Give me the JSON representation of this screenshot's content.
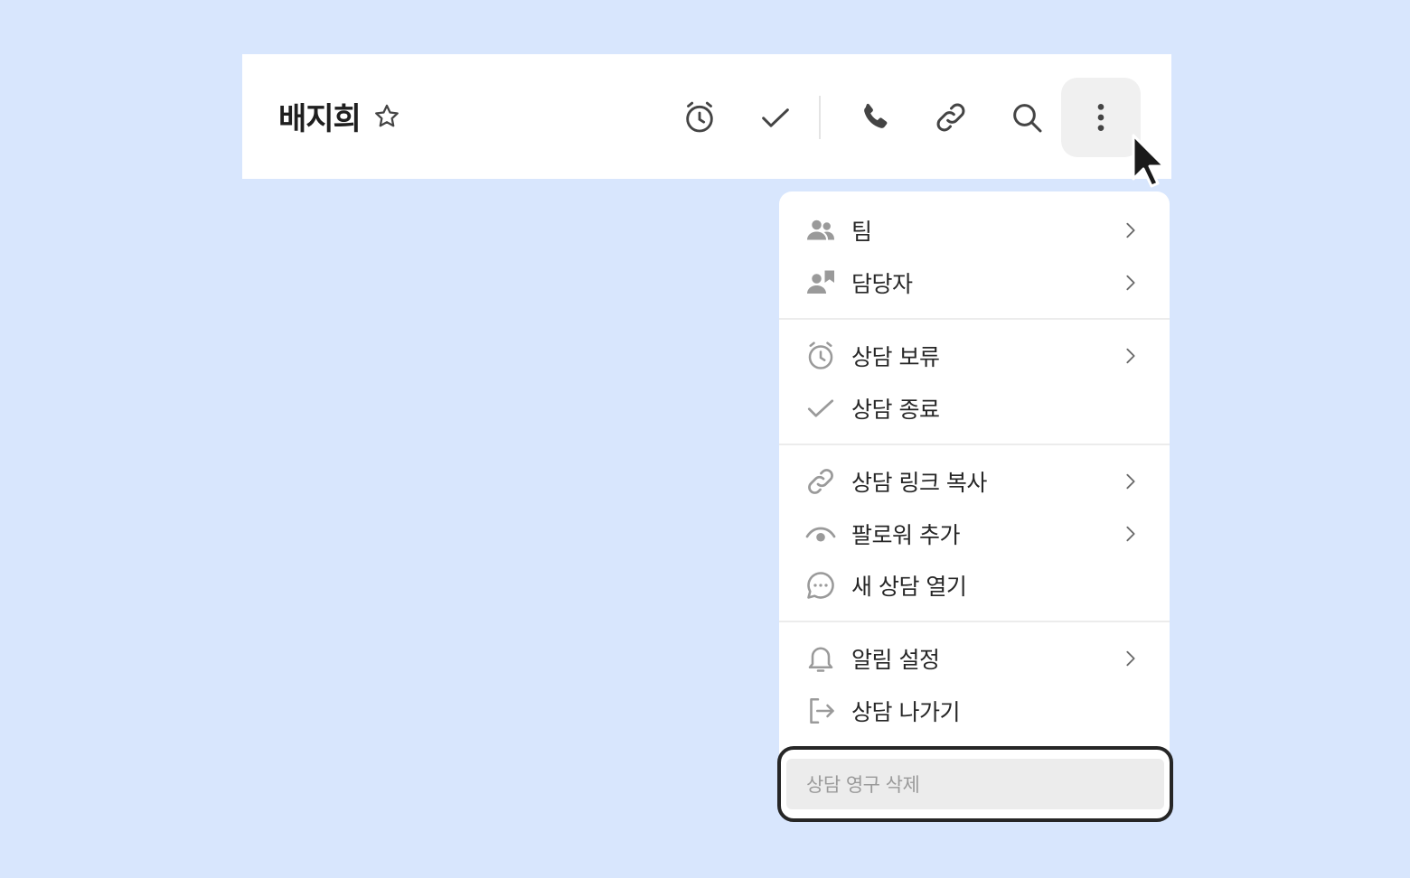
{
  "header": {
    "title": "배지희",
    "icons": [
      "star-icon",
      "alarm-clock-icon",
      "check-icon",
      "phone-icon",
      "link-icon",
      "search-icon",
      "more-vertical-icon"
    ]
  },
  "menu": {
    "items": [
      {
        "label": "팀",
        "icon": "team-icon",
        "has_submenu": true
      },
      {
        "label": "담당자",
        "icon": "assignee-icon",
        "has_submenu": true
      },
      {
        "label": "상담 보류",
        "icon": "alarm-clock-icon",
        "has_submenu": true
      },
      {
        "label": "상담 종료",
        "icon": "check-icon",
        "has_submenu": false
      },
      {
        "label": "상담 링크 복사",
        "icon": "link-icon",
        "has_submenu": true
      },
      {
        "label": "팔로워 추가",
        "icon": "eye-icon",
        "has_submenu": true
      },
      {
        "label": "새 상담 열기",
        "icon": "chat-bubble-icon",
        "has_submenu": false
      },
      {
        "label": "알림 설정",
        "icon": "bell-icon",
        "has_submenu": true
      },
      {
        "label": "상담 나가기",
        "icon": "exit-icon",
        "has_submenu": false
      }
    ],
    "delete_label": "상담 영구 삭제"
  },
  "colors": {
    "background": "#d8e6fd",
    "icon_gray": "#9a9a9a",
    "header_icon": "#444444",
    "delete_bg": "#ececec",
    "highlight_border": "#262626"
  }
}
